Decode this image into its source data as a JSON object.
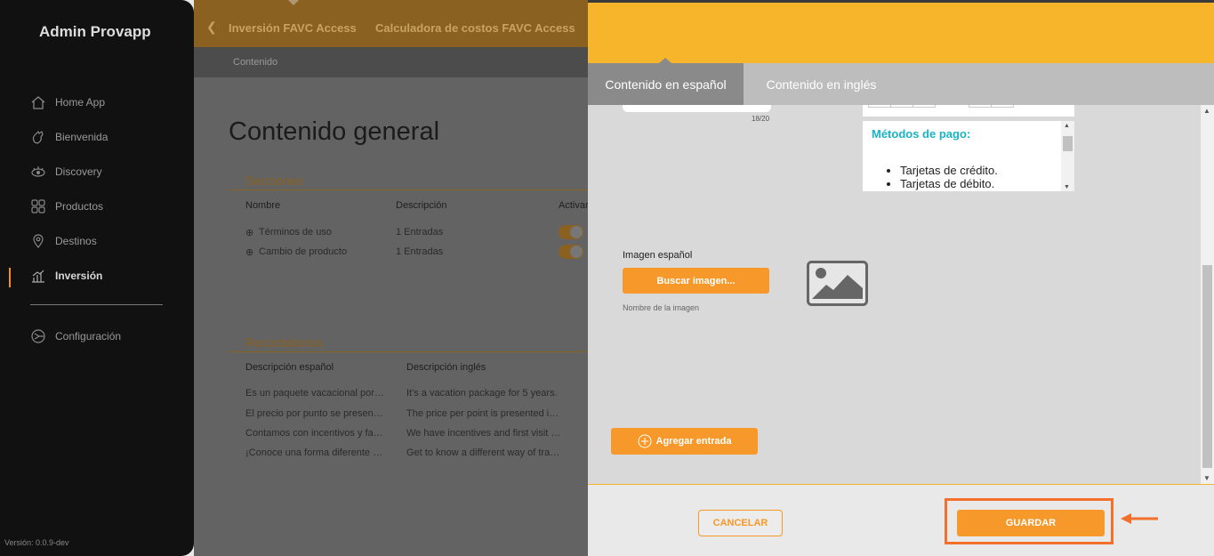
{
  "sidebar": {
    "brand": "Admin Provapp",
    "items": [
      {
        "label": "Home App",
        "icon": "home-icon"
      },
      {
        "label": "Bienvenida",
        "icon": "wave-hand-icon"
      },
      {
        "label": "Discovery",
        "icon": "eye-icon"
      },
      {
        "label": "Productos",
        "icon": "grid-icon"
      },
      {
        "label": "Destinos",
        "icon": "location-pin-icon"
      },
      {
        "label": "Inversión",
        "icon": "bar-chart-icon",
        "active": true
      }
    ],
    "settings": {
      "label": "Configuración",
      "icon": "settings-icon"
    },
    "version": "Versión: 0.0.9-dev"
  },
  "topbar": {
    "back_icon": "chevron-left-icon",
    "crumb1": "Inversión FAVC Access",
    "crumb2": "Calculadora de costos FAVC Access"
  },
  "subbar": {
    "label": "Contenido"
  },
  "background_page": {
    "title": "Contenido general",
    "sections": {
      "title": "Secciones",
      "headers": {
        "name": "Nombre",
        "description": "Descripción",
        "active": "Activar"
      },
      "rows": [
        {
          "name": "Términos de uso",
          "description": "1 Entradas"
        },
        {
          "name": "Cambio de producto",
          "description": "1 Entradas"
        }
      ]
    },
    "reminders": {
      "title": "Recordatorios",
      "headers": {
        "es": "Descripción español",
        "en": "Descripción inglés"
      },
      "rows": [
        {
          "es": "Es un paquete vacacional por…",
          "en": "It's a vacation package for 5 years."
        },
        {
          "es": "El precio por punto se presen…",
          "en": "The price per point is presented i…"
        },
        {
          "es": "Contamos con incentivos y fa…",
          "en": "We have incentives and first visit …"
        },
        {
          "es": "¡Conoce una forma diferente …",
          "en": "Get to know a different way of tra…"
        }
      ]
    }
  },
  "panel": {
    "tabs": {
      "spanish": "Contenido en español",
      "english": "Contenido en inglés"
    },
    "counter": "18/20",
    "editor": {
      "heading": "Métodos de pago:",
      "items": [
        "Tarjetas de crédito.",
        "Tarjetas de débito."
      ]
    },
    "image": {
      "label": "Imagen español",
      "button": "Buscar imagen...",
      "name_placeholder": "Nombre de la imagen",
      "placeholder_icon": "image-placeholder-icon"
    },
    "add_entry": "Agregar entrada",
    "footer": {
      "cancel": "CANCELAR",
      "save": "GUARDAR"
    },
    "colors": {
      "accent": "#f7b52b",
      "button": "#f7982a",
      "highlight": "#f26f2c",
      "editor_heading": "#18b3c4"
    }
  }
}
